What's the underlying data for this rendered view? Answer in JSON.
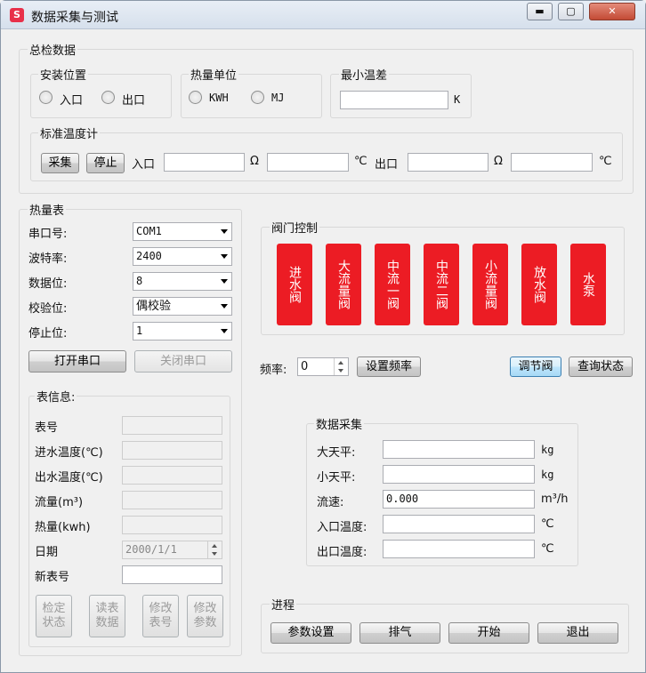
{
  "window": {
    "title": "数据采集与测试",
    "icon_letter": "S",
    "controls": {
      "minimize": "▬",
      "maximize": "▢",
      "close": "✕"
    }
  },
  "total_data": {
    "legend": "总检数据",
    "install_position": {
      "legend": "安装位置",
      "options": [
        "入口",
        "出口"
      ]
    },
    "heat_unit": {
      "legend": "热量单位",
      "options": [
        "KWH",
        "MJ"
      ]
    },
    "min_temp_diff": {
      "legend": "最小温差",
      "value": "",
      "unit": "K"
    },
    "standard_thermometer": {
      "legend": "标准温度计",
      "collect_label": "采集",
      "stop_label": "停止",
      "inlet_label": "入口",
      "outlet_label": "出口",
      "ohm": "Ω",
      "celsius": "℃",
      "inlet_value": "",
      "inlet_temp": "",
      "outlet_value": "",
      "outlet_temp": ""
    }
  },
  "heat_meter": {
    "legend": "热量表",
    "fields": [
      {
        "label": "串口号:",
        "value": "COM1"
      },
      {
        "label": "波特率:",
        "value": "2400"
      },
      {
        "label": "数据位:",
        "value": "8"
      },
      {
        "label": "校验位:",
        "value": "偶校验"
      },
      {
        "label": "停止位:",
        "value": "1"
      }
    ],
    "open_port_label": "打开串口",
    "close_port_label": "关闭串口",
    "meter_info": {
      "legend": "表信息:",
      "rows": [
        {
          "label": "表号",
          "value": ""
        },
        {
          "label": "进水温度(℃)",
          "value": ""
        },
        {
          "label": "出水温度(℃)",
          "value": ""
        },
        {
          "label": "流量(m³)",
          "value": ""
        },
        {
          "label": "热量(kwh)",
          "value": ""
        },
        {
          "label": "日期",
          "value": "2000/1/1"
        },
        {
          "label": "新表号",
          "value": ""
        }
      ],
      "buttons": [
        "检定状态",
        "读表数据",
        "修改表号",
        "修改参数"
      ]
    }
  },
  "valve_control": {
    "legend": "阀门控制",
    "valves": [
      "进水阀",
      "大流量阀",
      "中流一阀",
      "中流二阀",
      "小流量阀",
      "放水阀",
      "水泵"
    ],
    "frequency_label": "频率:",
    "frequency_value": "0",
    "set_frequency_label": "设置频率",
    "adjust_valve_label": "调节阀",
    "query_status_label": "查询状态"
  },
  "data_collection": {
    "legend": "数据采集",
    "rows": [
      {
        "label": "大天平:",
        "value": "",
        "unit": "kg"
      },
      {
        "label": "小天平:",
        "value": "",
        "unit": "kg"
      },
      {
        "label": "流速:",
        "value": "0.000",
        "unit": "m³/h"
      },
      {
        "label": "入口温度:",
        "value": "",
        "unit": "℃"
      },
      {
        "label": "出口温度:",
        "value": "",
        "unit": "℃"
      }
    ]
  },
  "process": {
    "legend": "进程",
    "buttons": [
      "参数设置",
      "排气",
      "开始",
      "退出"
    ]
  }
}
